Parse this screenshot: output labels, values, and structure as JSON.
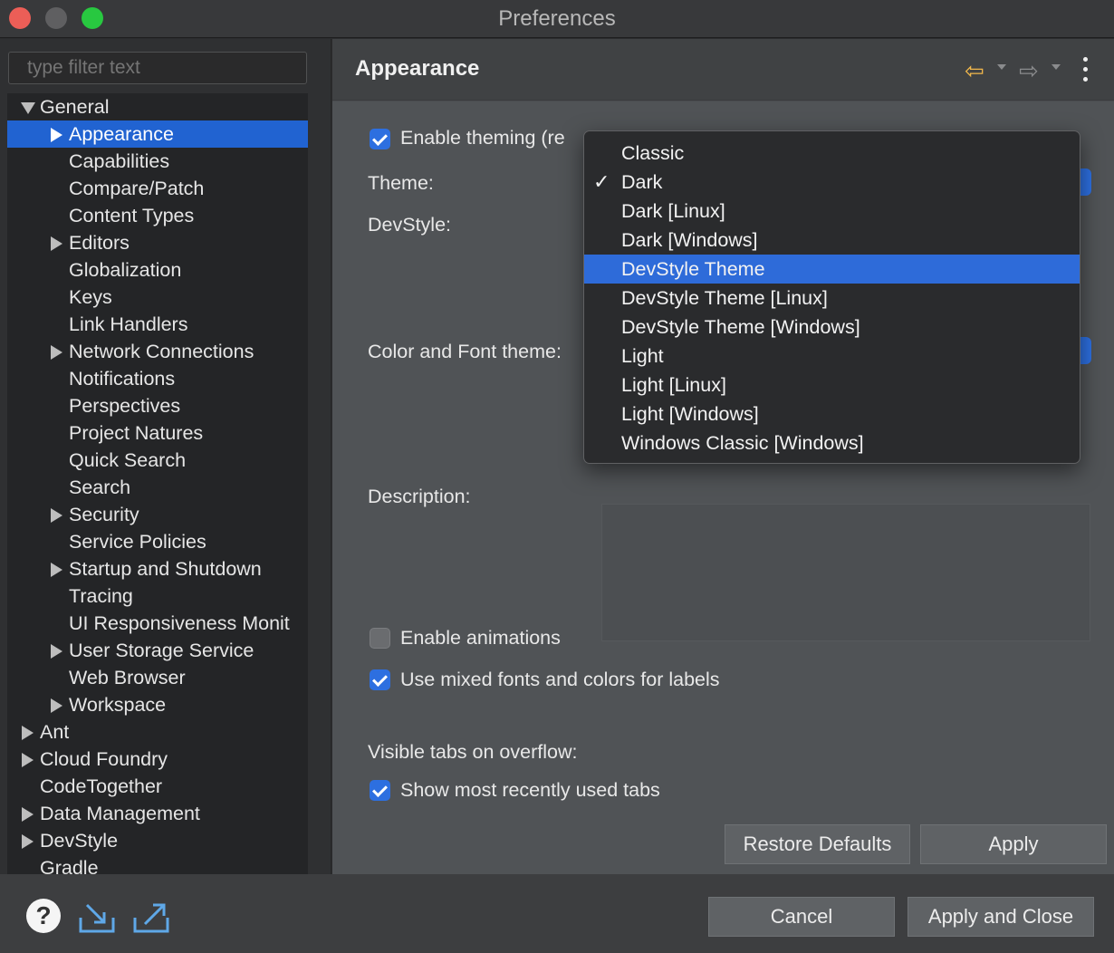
{
  "window": {
    "title": "Preferences"
  },
  "filter": {
    "placeholder": "type filter text"
  },
  "tree": [
    {
      "label": "General",
      "indent": 0,
      "expander": "expanded",
      "selected": false
    },
    {
      "label": "Appearance",
      "indent": 1,
      "expander": "collapsed",
      "selected": true
    },
    {
      "label": "Capabilities",
      "indent": 1,
      "expander": "none",
      "selected": false
    },
    {
      "label": "Compare/Patch",
      "indent": 1,
      "expander": "none",
      "selected": false
    },
    {
      "label": "Content Types",
      "indent": 1,
      "expander": "none",
      "selected": false
    },
    {
      "label": "Editors",
      "indent": 1,
      "expander": "collapsed",
      "selected": false
    },
    {
      "label": "Globalization",
      "indent": 1,
      "expander": "none",
      "selected": false
    },
    {
      "label": "Keys",
      "indent": 1,
      "expander": "none",
      "selected": false
    },
    {
      "label": "Link Handlers",
      "indent": 1,
      "expander": "none",
      "selected": false
    },
    {
      "label": "Network Connections",
      "indent": 1,
      "expander": "collapsed",
      "selected": false
    },
    {
      "label": "Notifications",
      "indent": 1,
      "expander": "none",
      "selected": false
    },
    {
      "label": "Perspectives",
      "indent": 1,
      "expander": "none",
      "selected": false
    },
    {
      "label": "Project Natures",
      "indent": 1,
      "expander": "none",
      "selected": false
    },
    {
      "label": "Quick Search",
      "indent": 1,
      "expander": "none",
      "selected": false
    },
    {
      "label": "Search",
      "indent": 1,
      "expander": "none",
      "selected": false
    },
    {
      "label": "Security",
      "indent": 1,
      "expander": "collapsed",
      "selected": false
    },
    {
      "label": "Service Policies",
      "indent": 1,
      "expander": "none",
      "selected": false
    },
    {
      "label": "Startup and Shutdown",
      "indent": 1,
      "expander": "collapsed",
      "selected": false
    },
    {
      "label": "Tracing",
      "indent": 1,
      "expander": "none",
      "selected": false
    },
    {
      "label": "UI Responsiveness Monit",
      "indent": 1,
      "expander": "none",
      "selected": false
    },
    {
      "label": "User Storage Service",
      "indent": 1,
      "expander": "collapsed",
      "selected": false
    },
    {
      "label": "Web Browser",
      "indent": 1,
      "expander": "none",
      "selected": false
    },
    {
      "label": "Workspace",
      "indent": 1,
      "expander": "collapsed",
      "selected": false
    },
    {
      "label": "Ant",
      "indent": 0,
      "expander": "collapsed",
      "selected": false
    },
    {
      "label": "Cloud Foundry",
      "indent": 0,
      "expander": "collapsed",
      "selected": false
    },
    {
      "label": "CodeTogether",
      "indent": 0,
      "expander": "none",
      "selected": false
    },
    {
      "label": "Data Management",
      "indent": 0,
      "expander": "collapsed",
      "selected": false
    },
    {
      "label": "DevStyle",
      "indent": 0,
      "expander": "collapsed",
      "selected": false
    },
    {
      "label": "Gradle",
      "indent": 0,
      "expander": "none",
      "selected": false
    }
  ],
  "page": {
    "title": "Appearance",
    "enable_theming": {
      "label": "Enable theming (re",
      "checked": true
    },
    "theme_label": "Theme:",
    "devstyle_label": "DevStyle:",
    "color_font_label": "Color and Font theme:",
    "description_label": "Description:",
    "enable_animations": {
      "label": "Enable animations",
      "checked": false
    },
    "mixed_fonts": {
      "label": "Use mixed fonts and colors for labels",
      "checked": true
    },
    "tabs_overflow_label": "Visible tabs on overflow:",
    "show_mru_tabs": {
      "label": "Show most recently used tabs",
      "checked": true
    },
    "restore_defaults": "Restore Defaults",
    "apply": "Apply"
  },
  "theme_dropdown": {
    "checked_option": "Dark",
    "highlighted_option": "DevStyle Theme",
    "options": [
      "Classic",
      "Dark",
      "Dark [Linux]",
      "Dark [Windows]",
      "DevStyle Theme",
      "DevStyle Theme [Linux]",
      "DevStyle Theme [Windows]",
      "Light",
      "Light [Linux]",
      "Light [Windows]",
      "Windows Classic [Windows]"
    ]
  },
  "footer": {
    "help_glyph": "?",
    "cancel": "Cancel",
    "apply_close": "Apply and Close"
  },
  "colors": {
    "accent": "#2163d1",
    "back_arrow": "#f2b84b"
  },
  "icons": {
    "back": "arrow-left-icon",
    "forward": "arrow-right-icon",
    "menu": "kebab-menu-icon",
    "help": "help-icon",
    "import": "import-icon",
    "export": "export-icon"
  }
}
